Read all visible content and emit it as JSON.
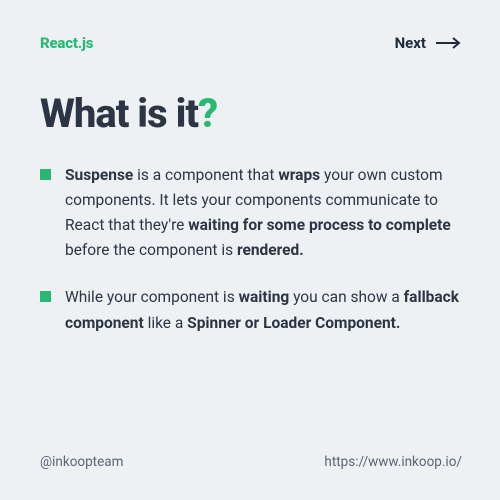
{
  "header": {
    "brand": "React.js",
    "next_label": "Next"
  },
  "title": {
    "text": "What is it",
    "punct": "?"
  },
  "bullets": [
    {
      "t1": "Suspense",
      "t2": " is a component that ",
      "t3": "wraps",
      "t4": " your own custom components. It lets your components communicate to React that they're ",
      "t5": "waiting for some process to complete",
      "t6": " before the component is ",
      "t7": "rendered."
    },
    {
      "t1": "While your component is ",
      "t2": "waiting",
      "t3": " you can show a ",
      "t4": "fallback component",
      "t5": " like a ",
      "t6": "Spinner or Loader Component."
    }
  ],
  "footer": {
    "handle": "@inkoopteam",
    "url": "https://www.inkoop.io/"
  },
  "colors": {
    "accent": "#27b874",
    "text": "#2b3544",
    "bg": "#eef1f4"
  }
}
